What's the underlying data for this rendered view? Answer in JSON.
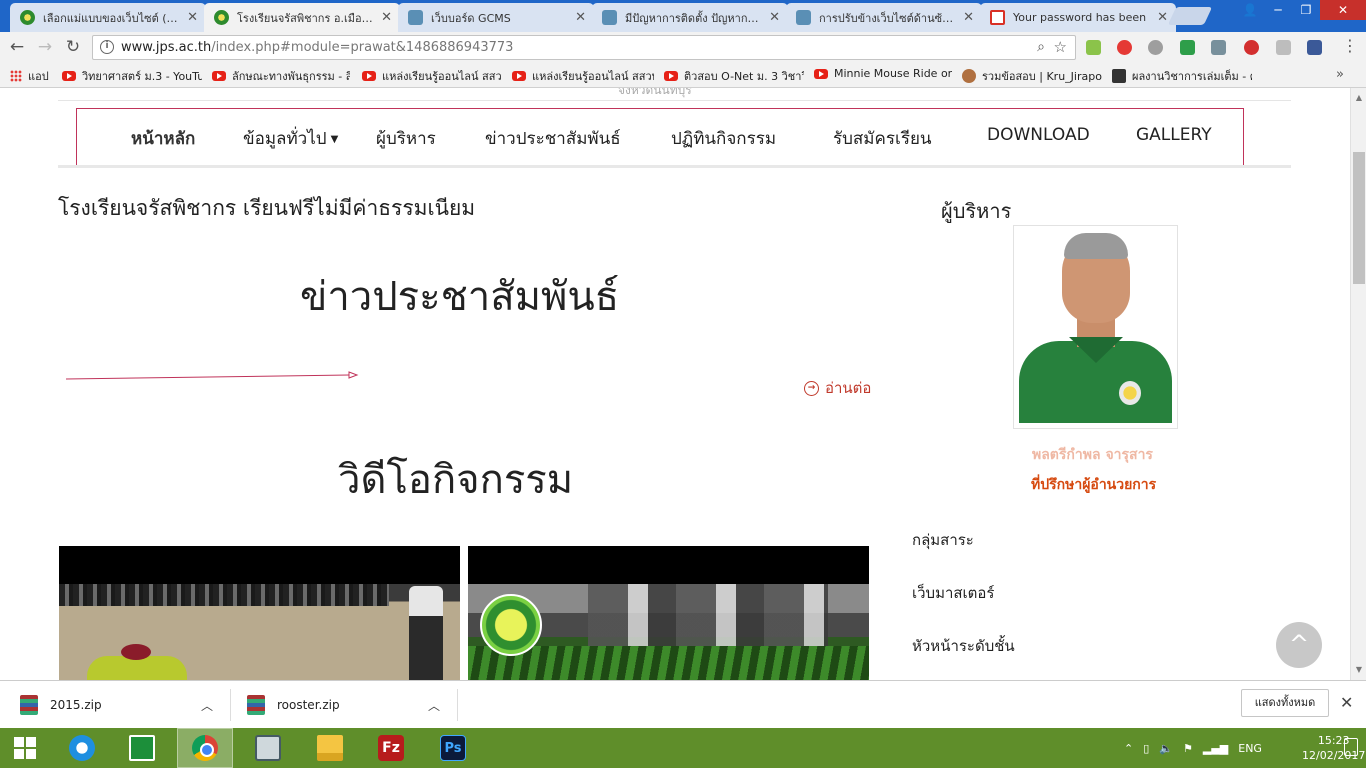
{
  "browser": {
    "tabs": [
      {
        "title": "เลือกแม่แบบของเว็บไซต์ (Adm",
        "icon": "seal-icon"
      },
      {
        "title": "โรงเรียนจรัสพิชากร อ.เมือง ส",
        "icon": "seal-icon",
        "active": true
      },
      {
        "title": "เว็บบอร์ด GCMS",
        "icon": "elephant-icon"
      },
      {
        "title": "มีปัญหาการติดตั้ง ปัญหาการติ",
        "icon": "elephant-icon"
      },
      {
        "title": "การปรับข้างเว็บไซต์ด้านซ้ายมื",
        "icon": "elephant-icon"
      },
      {
        "title": "Your password has been",
        "icon": "gmail-icon"
      }
    ],
    "address": {
      "host": "www.jps.ac.th",
      "path": "/index.php#module=prawat&1486886943773"
    },
    "bookmarks": [
      {
        "label": "แอป",
        "icon": "apps-icon"
      },
      {
        "label": "วิทยาศาสตร์ ม.3 - YouTu",
        "icon": "youtube-icon"
      },
      {
        "label": "ลักษณะทางพันธุกรรม - สิ",
        "icon": "youtube-icon"
      },
      {
        "label": "แหล่งเรียนรู้ออนไลน์ สสวท",
        "icon": "youtube-icon"
      },
      {
        "label": "แหล่งเรียนรู้ออนไลน์ สสวท",
        "icon": "youtube-icon"
      },
      {
        "label": "ติวสอบ O-Net ม. 3 วิชาวิ",
        "icon": "youtube-icon"
      },
      {
        "label": "Minnie Mouse Ride on",
        "icon": "youtube-icon"
      },
      {
        "label": "รวมข้อสอบ | Kru_Jirapo",
        "icon": "avatar-icon"
      },
      {
        "label": "ผลงานวิชาการเล่มเต็ม - ค",
        "icon": "book-icon"
      }
    ]
  },
  "site": {
    "top_text": "จังหวัดนนทบุรี",
    "nav": [
      {
        "label": "หน้าหลัก"
      },
      {
        "label": "ข้อมูลทั่วไป",
        "dropdown": true
      },
      {
        "label": "ผู้บริหาร"
      },
      {
        "label": "ข่าวประชาสัมพันธ์"
      },
      {
        "label": "ปฏิทินกิจกรรม"
      },
      {
        "label": "รับสมัครเรียน"
      },
      {
        "label": "DOWNLOAD"
      },
      {
        "label": "GALLERY"
      }
    ],
    "school_heading": "โรงเรียนจรัสพิชากร เรียนฟรีไม่มีค่าธรรมเนียม",
    "news_title": "ข่าวประชาสัมพันธ์",
    "read_more": "อ่านต่อ",
    "video_title": "วิดีโอกิจกรรม",
    "sidebar": {
      "title": "ผู้บริหาร",
      "exec_name": "พลตรีกำพล จารุสาร",
      "exec_role": "ที่ปรึกษาผู้อำนวยการ",
      "links": [
        "กลุ่มสาระ",
        "เว็บมาสเตอร์",
        "หัวหน้าระดับชั้น"
      ]
    }
  },
  "downloads": {
    "items": [
      {
        "name": "2015.zip"
      },
      {
        "name": "rooster.zip"
      }
    ],
    "show_all": "แสดงทั้งหมด"
  },
  "taskbar": {
    "language": "ENG",
    "time": "15:23",
    "date": "12/02/2017"
  }
}
